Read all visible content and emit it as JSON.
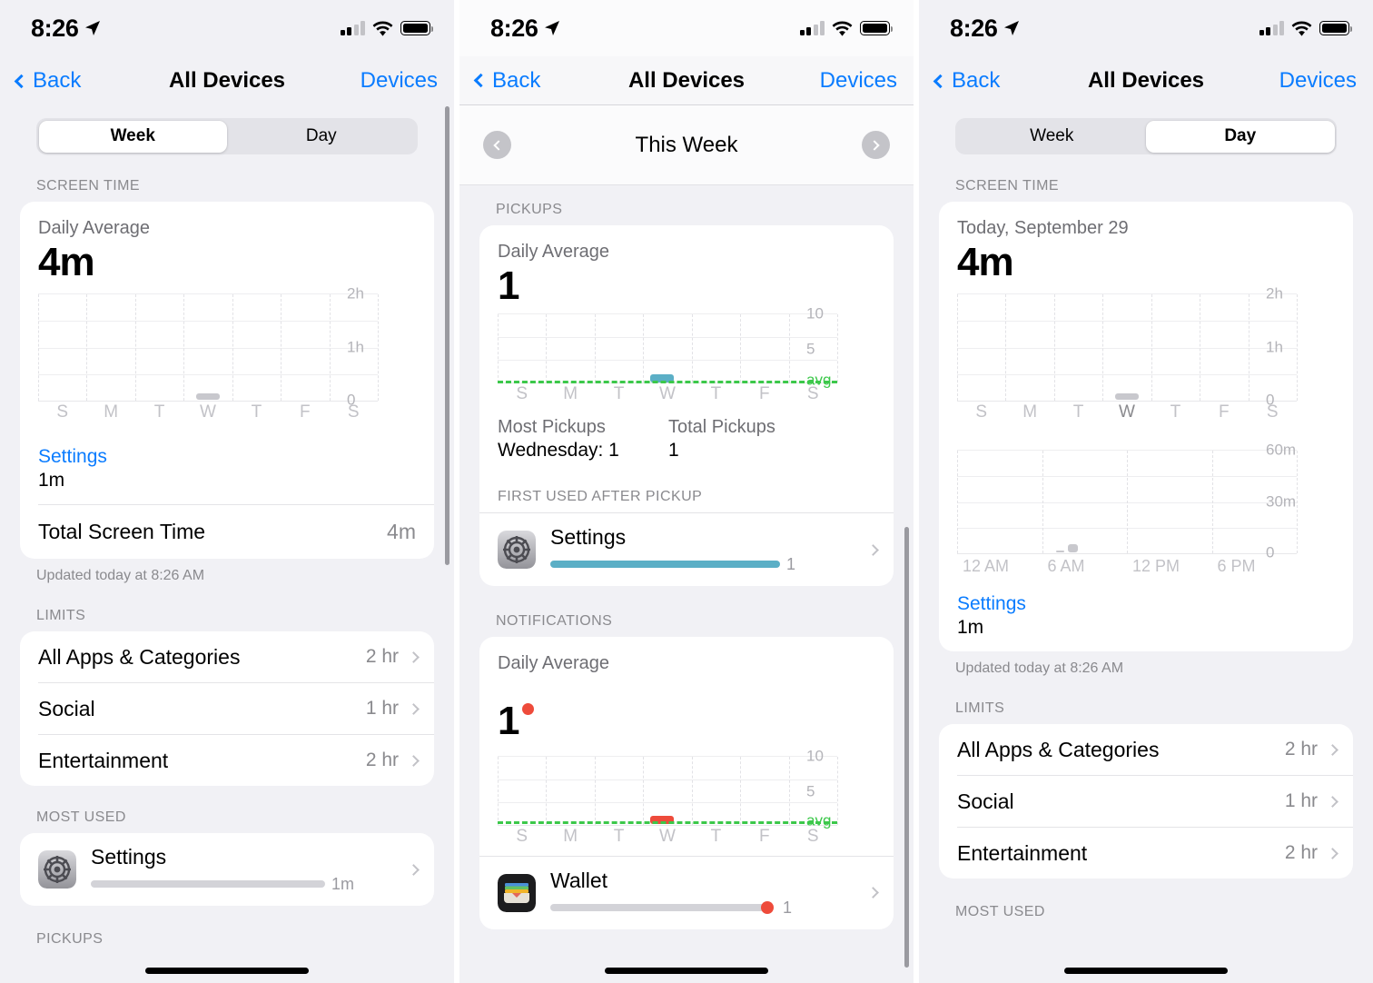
{
  "status_bar": {
    "time": "8:26",
    "location_icon": "location-arrow-icon",
    "signal_icon": "cellular-signal-icon",
    "wifi_icon": "wifi-icon",
    "battery_icon": "battery-full-icon"
  },
  "nav": {
    "back": "Back",
    "title": "All Devices",
    "right": "Devices"
  },
  "panel1": {
    "segments": [
      {
        "label": "Week",
        "active": true
      },
      {
        "label": "Day",
        "active": false
      }
    ],
    "screen_time_header": "SCREEN TIME",
    "card": {
      "subtitle": "Daily Average",
      "value": "4m",
      "app_link": "Settings",
      "app_amount": "1m",
      "total_label": "Total Screen Time",
      "total_value": "4m"
    },
    "updated": "Updated today at 8:26 AM",
    "limits_header": "LIMITS",
    "limits": [
      {
        "name": "All Apps & Categories",
        "value": "2 hr"
      },
      {
        "name": "Social",
        "value": "1 hr"
      },
      {
        "name": "Entertainment",
        "value": "2 hr"
      }
    ],
    "most_used_header": "MOST USED",
    "most_used": [
      {
        "name": "Settings",
        "value": "1m",
        "icon": "settings-app-icon"
      }
    ],
    "next_header": "PICKUPS"
  },
  "panel2": {
    "week_nav": {
      "prev_icon": "chevron-left-circle-icon",
      "title": "This Week",
      "next_icon": "chevron-right-circle-icon"
    },
    "pickups_header": "PICKUPS",
    "pickups_card": {
      "subtitle": "Daily Average",
      "value": "1",
      "most_pickups_label": "Most Pickups",
      "most_pickups_value": "Wednesday: 1",
      "total_pickups_label": "Total Pickups",
      "total_pickups_value": "1",
      "first_used_header": "FIRST USED AFTER PICKUP",
      "first_used": [
        {
          "name": "Settings",
          "value": "1",
          "icon": "settings-app-icon"
        }
      ]
    },
    "notifications_header": "NOTIFICATIONS",
    "notifications_card": {
      "subtitle": "Daily Average",
      "value": "1",
      "apps": [
        {
          "name": "Wallet",
          "value": "1",
          "icon": "wallet-app-icon"
        }
      ]
    }
  },
  "panel3": {
    "segments": [
      {
        "label": "Week",
        "active": false
      },
      {
        "label": "Day",
        "active": true
      }
    ],
    "screen_time_header": "SCREEN TIME",
    "card": {
      "subtitle": "Today, September 29",
      "value": "4m",
      "app_link": "Settings",
      "app_amount": "1m"
    },
    "updated": "Updated today at 8:26 AM",
    "limits_header": "LIMITS",
    "limits": [
      {
        "name": "All Apps & Categories",
        "value": "2 hr"
      },
      {
        "name": "Social",
        "value": "1 hr"
      },
      {
        "name": "Entertainment",
        "value": "2 hr"
      }
    ],
    "most_used_header": "MOST USED"
  },
  "colors": {
    "accent": "#0a7cff",
    "avg_green": "#3cc84a",
    "pickup_teal": "#5bafc6",
    "notification_red": "#ee4b3b",
    "bar_gray": "#c8c8cd",
    "page_bg": "#f1f1f5"
  },
  "chart_data": [
    {
      "type": "bar",
      "title": "Screen Time - Week",
      "panel": "panel1",
      "categories": [
        "S",
        "M",
        "T",
        "W",
        "T",
        "F",
        "S"
      ],
      "values": [
        0,
        0,
        0,
        4,
        0,
        0,
        0
      ],
      "unit": "minutes",
      "ylabel": "",
      "xlabel": "",
      "ytick_labels": [
        "0",
        "1h",
        "2h"
      ],
      "ylim": [
        0,
        120
      ],
      "gridlines": [
        0,
        30,
        60,
        90,
        120
      ],
      "grid": true,
      "legend": "none"
    },
    {
      "type": "bar",
      "title": "Pickups - This Week",
      "panel": "panel2",
      "categories": [
        "S",
        "M",
        "T",
        "W",
        "T",
        "F",
        "S"
      ],
      "values": [
        0,
        0,
        0,
        1,
        0,
        0,
        0
      ],
      "unit": "pickups",
      "ytick_labels": [
        "5",
        "10"
      ],
      "ylim": [
        0,
        12
      ],
      "gridlines": [
        0,
        2.5,
        5,
        7.5,
        10,
        12
      ],
      "average_line": {
        "label": "avg",
        "value": 1,
        "color": "#3cc84a",
        "style": "dashed"
      },
      "bar_color": "#5bafc6",
      "grid": true
    },
    {
      "type": "bar",
      "title": "Notifications - This Week",
      "panel": "panel2",
      "categories": [
        "S",
        "M",
        "T",
        "W",
        "T",
        "F",
        "S"
      ],
      "values": [
        0,
        0,
        0,
        1,
        0,
        0,
        0
      ],
      "unit": "notifications",
      "ytick_labels": [
        "5",
        "10"
      ],
      "ylim": [
        0,
        12
      ],
      "gridlines": [
        0,
        2.5,
        5,
        7.5,
        10,
        12
      ],
      "average_line": {
        "label": "avg",
        "value": 1,
        "color": "#3cc84a",
        "style": "dashed"
      },
      "bar_color": "#ee4b3b",
      "grid": true
    },
    {
      "type": "bar",
      "title": "Screen Time - Week (Day view)",
      "panel": "panel3",
      "categories": [
        "S",
        "M",
        "T",
        "W",
        "T",
        "F",
        "S"
      ],
      "values": [
        0,
        0,
        0,
        4,
        0,
        0,
        0
      ],
      "unit": "minutes",
      "ytick_labels": [
        "0",
        "1h",
        "2h"
      ],
      "ylim": [
        0,
        120
      ],
      "gridlines": [
        0,
        30,
        60,
        90,
        120
      ],
      "highlight_category": "W",
      "grid": true
    },
    {
      "type": "bar",
      "title": "Screen Time - Today hourly",
      "panel": "panel3",
      "x": [
        "12 AM",
        "6 AM",
        "12 PM",
        "6 PM"
      ],
      "values": [
        0,
        0,
        0,
        0,
        0,
        0,
        0,
        1,
        3,
        0,
        0,
        0,
        0,
        0,
        0,
        0,
        0,
        0,
        0,
        0,
        0,
        0,
        0,
        0
      ],
      "unit": "minutes",
      "ytick_labels": [
        "0",
        "30m",
        "60m"
      ],
      "ylim": [
        0,
        60
      ],
      "gridlines": [
        0,
        15,
        30,
        45,
        60
      ],
      "grid": true
    }
  ]
}
